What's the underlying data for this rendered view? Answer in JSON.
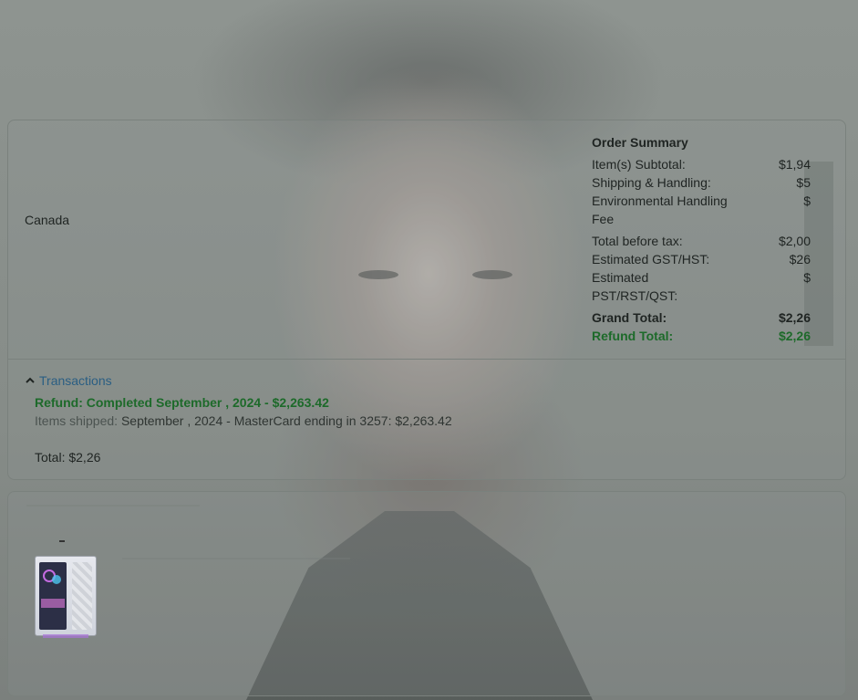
{
  "order_summary": {
    "title": "Order Summary",
    "rows": [
      {
        "label": "Item(s) Subtotal:",
        "value": "$1,94"
      },
      {
        "label": "Shipping & Handling:",
        "value": "$5"
      },
      {
        "label": "Environmental Handling Fee",
        "value": "$"
      },
      {
        "label": "Total before tax:",
        "value": "$2,00"
      },
      {
        "label": "Estimated GST/HST:",
        "value": "$26"
      },
      {
        "label": "Estimated PST/RST/QST:",
        "value": "$"
      },
      {
        "label": "Grand Total:",
        "value": "$2,26"
      },
      {
        "label": "Refund Total:",
        "value": "$2,26"
      }
    ]
  },
  "shipping": {
    "country": "Canada"
  },
  "transactions": {
    "toggle_label": "Transactions",
    "refund_line": "Refund: Completed September     , 2024 - $2,263.42",
    "items_label": "Items shipped:",
    "items_detail": "September     , 2024 - MasterCard ending in 3257: $2,263.42",
    "total_label": "Total: $2,26"
  },
  "product": {
    "image_icon": "desktop-pc-tower-image"
  },
  "colors": {
    "refund_green": "#1d6a2a",
    "link_blue": "#2a5e83"
  }
}
